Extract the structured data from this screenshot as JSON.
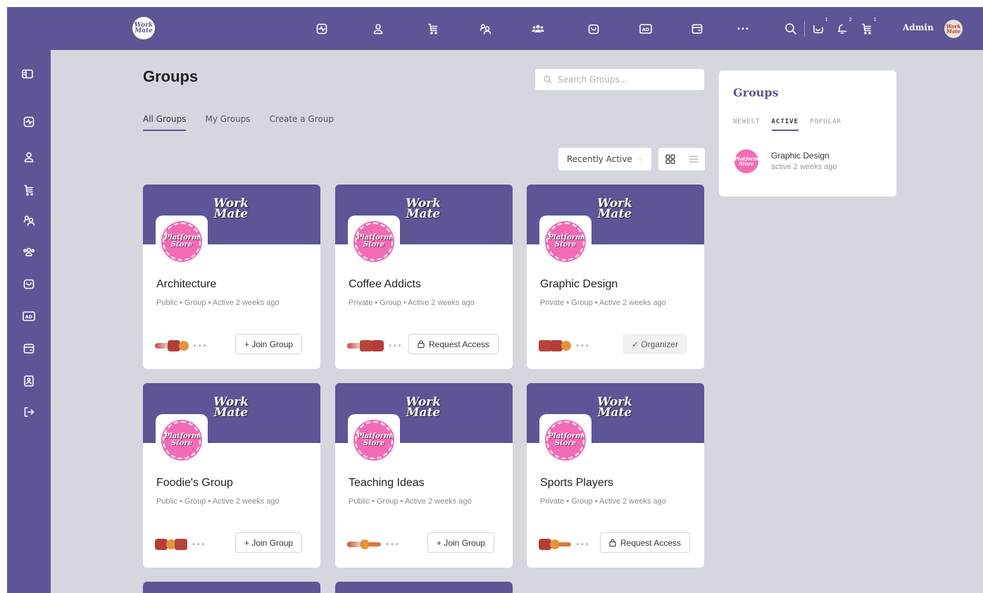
{
  "brand": {
    "logo_text": "Work Mate"
  },
  "topbar": {
    "icons": [
      "activity-icon",
      "profile-icon",
      "cart-icon",
      "friends-icon",
      "groups-icon",
      "store-icon",
      "ads-icon",
      "wallet-icon",
      "more-icon"
    ],
    "more_label": "•••",
    "badges": {
      "messages": "1",
      "notifications": "2",
      "cart": "1"
    },
    "admin_name": "Admin",
    "avatar_text": "Work Mate"
  },
  "sidebar": {
    "icons": [
      "panel-toggle-icon",
      "activity-icon",
      "profile-icon",
      "cart-icon",
      "friends-icon",
      "groups-icon",
      "store-icon",
      "ads-icon",
      "wallet-icon",
      "contacts-icon",
      "logout-icon"
    ]
  },
  "page": {
    "title": "Groups",
    "search_placeholder": "Search Groups...",
    "tabs": [
      "All Groups",
      "My Groups",
      "Create a Group"
    ],
    "active_tab": 0,
    "sort": {
      "selected": "Recently Active"
    }
  },
  "group_cards": [
    {
      "name": "Architecture",
      "meta": "Public • Group • Active 2 weeks ago",
      "action": "+ Join Group",
      "action_type": "join",
      "member_styles": [
        "m1",
        "m2",
        "m3"
      ]
    },
    {
      "name": "Coffee Addicts",
      "meta": "Private • Group • Active 2 weeks ago",
      "action": "Request Access",
      "action_type": "request",
      "member_styles": [
        "m1",
        "m4",
        "m2"
      ]
    },
    {
      "name": "Graphic Design",
      "meta": "Private • Group • Active 2 weeks ago",
      "action": "✓ Organizer",
      "action_type": "organizer",
      "member_styles": [
        "m4",
        "m2",
        "m3"
      ]
    },
    {
      "name": "Foodie's Group",
      "meta": "Public • Group • Active 2 weeks ago",
      "action": "+ Join Group",
      "action_type": "join",
      "member_styles": [
        "m2",
        "m3",
        "m4"
      ]
    },
    {
      "name": "Teaching Ideas",
      "meta": "Public • Group • Active 2 weeks ago",
      "action": "+ Join Group",
      "action_type": "join",
      "member_styles": [
        "m1",
        "m3",
        "m5"
      ]
    },
    {
      "name": "Sports Players",
      "meta": "Private • Group • Active 2 weeks ago",
      "action": "Request Access",
      "action_type": "request",
      "member_styles": [
        "m2",
        "m3",
        "m5"
      ]
    }
  ],
  "card_cover_text": "Work Mate",
  "card_avatar_text": "Platform Store",
  "members_more": "•••",
  "widget": {
    "title": "Groups",
    "tabs": [
      "NEWEST",
      "ACTIVE",
      "POPULAR"
    ],
    "active_tab": 1,
    "item": {
      "name": "Graphic Design",
      "sub": "active 2 weeks ago",
      "avatar_text": "Platform Store"
    }
  },
  "colors": {
    "brand": "#5c5696",
    "page_bg": "#d4d7dd",
    "accent_pink": "#f26bb5"
  }
}
